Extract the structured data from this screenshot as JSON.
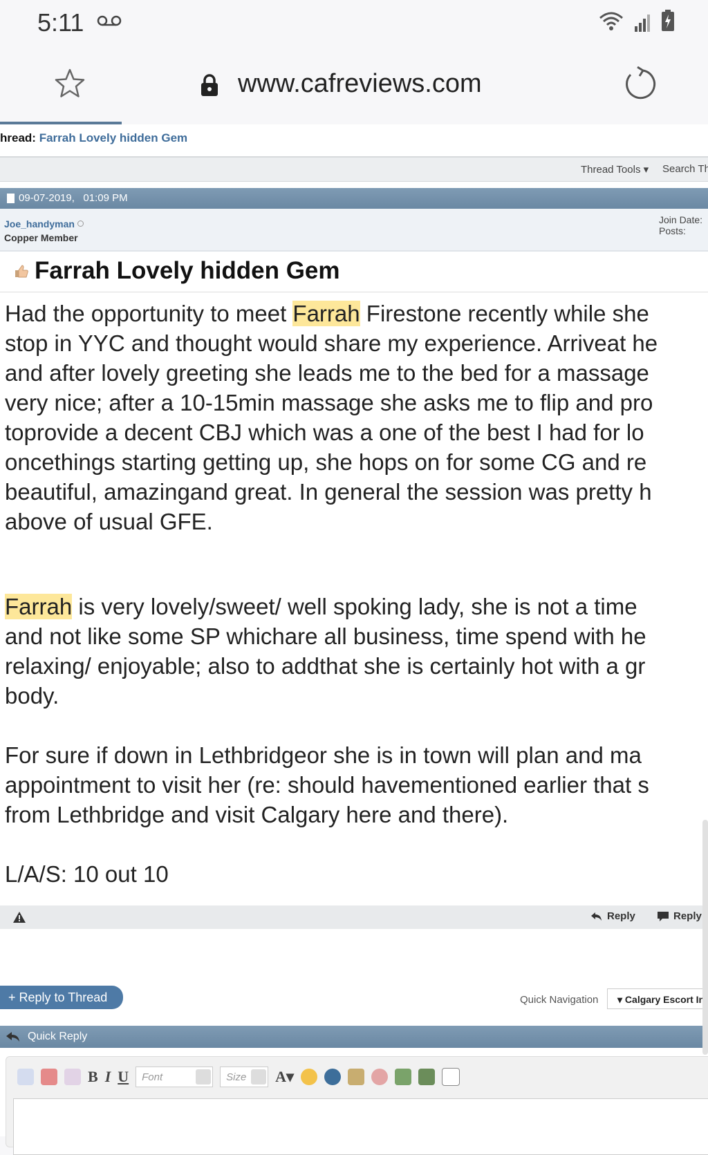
{
  "status_bar": {
    "time": "5:11"
  },
  "browser": {
    "url": "www.cafreviews.com"
  },
  "thread": {
    "label": "hread:",
    "title": "Farrah Lovely hidden Gem"
  },
  "toolbar": {
    "thread_tools": "Thread Tools",
    "search": "Search Th"
  },
  "post": {
    "date": "09-07-2019,   01:09 PM",
    "author": "Joe_handyman",
    "rank": "Copper Member",
    "join_date_label": "Join Date:",
    "posts_label": "Posts:",
    "title": "Farrah Lovely hidden Gem",
    "highlight": "Farrah",
    "p1_l1_rest": " Firestone recently while she",
    "p1_l1_start": "Had the opportunity to meet ",
    "p1_l2": "stop in YYC and thought would share my experience. Arriveat he",
    "p1_l3": "and after lovely greeting she leads me to the bed for a massage",
    "p1_l4": "very nice; after a 10-15min massage she asks me to flip and pro",
    "p1_l5": "toprovide a decent CBJ which was a one of the best I had for lo",
    "p1_l6": "oncethings starting getting up, she hops on for some CG and re",
    "p1_l7": "beautiful, amazingand great. In general the session was pretty h",
    "p1_l8": "above of usual GFE.",
    "p2_l1_rest": " is very lovely/sweet/ well spoking lady, she is not a time",
    "p2_l2": "and not like some SP whichare all business, time spend with he",
    "p2_l3": "relaxing/ enjoyable; also to addthat she is certainly hot with a gr",
    "p2_l4": "body.",
    "p3_l1": "For sure if down in Lethbridgeor she is in town will plan and ma",
    "p3_l2": "appointment to visit her (re: should havementioned earlier that s",
    "p3_l3": "from Lethbridge and visit Calgary here and there).",
    "p4_l1": "L/A/S: 10 out 10"
  },
  "post_footer": {
    "reply": "Reply",
    "reply_with_quote": "Reply w"
  },
  "nav": {
    "reply_to_thread": "+ Reply to Thread",
    "quick_navigation": "Quick Navigation",
    "forum_select": "Calgary Escort In"
  },
  "quick_reply": {
    "label": "Quick Reply",
    "font_placeholder": "Font",
    "size_placeholder": "Size"
  },
  "colors": {
    "link": "#3e6c9a",
    "header_bar": "#6a88a3",
    "highlight": "#fde79a",
    "button": "#4e7aa6"
  }
}
